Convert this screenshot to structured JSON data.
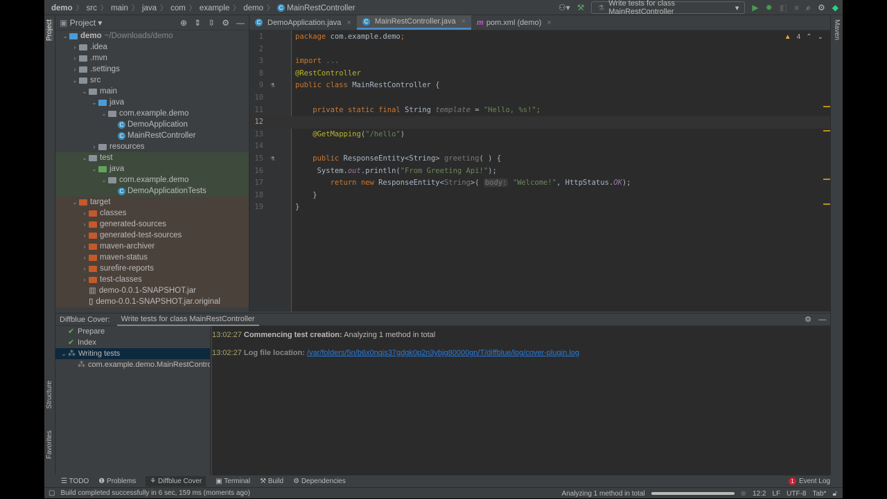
{
  "breadcrumb": [
    "demo",
    "src",
    "main",
    "java",
    "com",
    "example",
    "demo",
    "MainRestController"
  ],
  "toolbar": {
    "run_config": "Write tests for class MainRestController"
  },
  "project": {
    "title": "Project",
    "tree": [
      {
        "level": 0,
        "arrow": "v",
        "icon": "folder blue",
        "label": "demo",
        "extra": "~/Downloads/demo",
        "bold": true
      },
      {
        "level": 1,
        "arrow": ">",
        "icon": "folder",
        "label": ".idea"
      },
      {
        "level": 1,
        "arrow": ">",
        "icon": "folder",
        "label": ".mvn"
      },
      {
        "level": 1,
        "arrow": ">",
        "icon": "folder",
        "label": ".settings"
      },
      {
        "level": 1,
        "arrow": "v",
        "icon": "folder",
        "label": "src"
      },
      {
        "level": 2,
        "arrow": "v",
        "icon": "folder",
        "label": "main"
      },
      {
        "level": 3,
        "arrow": "v",
        "icon": "folder blue",
        "label": "java"
      },
      {
        "level": 4,
        "arrow": "v",
        "icon": "folder pkg",
        "label": "com.example.demo"
      },
      {
        "level": 5,
        "arrow": "",
        "icon": "class",
        "label": "DemoApplication"
      },
      {
        "level": 5,
        "arrow": "",
        "icon": "class",
        "label": "MainRestController"
      },
      {
        "level": 3,
        "arrow": ">",
        "icon": "folder",
        "label": "resources"
      },
      {
        "level": 2,
        "arrow": "v",
        "icon": "folder",
        "label": "test",
        "bg": "test"
      },
      {
        "level": 3,
        "arrow": "v",
        "icon": "folder green",
        "label": "java",
        "bg": "test"
      },
      {
        "level": 4,
        "arrow": "v",
        "icon": "folder pkg",
        "label": "com.example.demo",
        "bg": "test"
      },
      {
        "level": 5,
        "arrow": "",
        "icon": "class",
        "label": "DemoApplicationTests",
        "bg": "test"
      },
      {
        "level": 1,
        "arrow": "v",
        "icon": "folder orange",
        "label": "target",
        "bg": "target"
      },
      {
        "level": 2,
        "arrow": ">",
        "icon": "folder orange",
        "label": "classes",
        "bg": "target"
      },
      {
        "level": 2,
        "arrow": ">",
        "icon": "folder orange",
        "label": "generated-sources",
        "bg": "target"
      },
      {
        "level": 2,
        "arrow": ">",
        "icon": "folder orange",
        "label": "generated-test-sources",
        "bg": "target"
      },
      {
        "level": 2,
        "arrow": ">",
        "icon": "folder orange",
        "label": "maven-archiver",
        "bg": "target"
      },
      {
        "level": 2,
        "arrow": ">",
        "icon": "folder orange",
        "label": "maven-status",
        "bg": "target"
      },
      {
        "level": 2,
        "arrow": ">",
        "icon": "folder orange",
        "label": "surefire-reports",
        "bg": "target"
      },
      {
        "level": 2,
        "arrow": ">",
        "icon": "folder orange",
        "label": "test-classes",
        "bg": "target"
      },
      {
        "level": 2,
        "arrow": "",
        "icon": "jar",
        "label": "demo-0.0.1-SNAPSHOT.jar",
        "bg": "target"
      },
      {
        "level": 2,
        "arrow": "",
        "icon": "file",
        "label": "demo-0.0.1-SNAPSHOT.jar.original",
        "bg": "target"
      }
    ]
  },
  "tabs": [
    {
      "label": "DemoApplication.java",
      "active": false
    },
    {
      "label": "MainRestController.java",
      "active": true
    },
    {
      "label": "pom.xml (demo)",
      "active": false
    }
  ],
  "editor": {
    "warnings": "4",
    "lines": [
      {
        "n": "1",
        "t": [
          [
            "package ",
            "kw"
          ],
          [
            "com.example.demo",
            ""
          ],
          [
            ";",
            "kw"
          ]
        ]
      },
      {
        "n": "2",
        "t": []
      },
      {
        "n": "3",
        "t": [
          [
            "import ",
            "kw"
          ],
          [
            "...",
            "dim"
          ]
        ]
      },
      {
        "n": "8",
        "t": [
          [
            "@RestController",
            "ann"
          ]
        ]
      },
      {
        "n": "9",
        "t": [
          [
            "public class ",
            "kw"
          ],
          [
            "MainRestController {",
            ""
          ]
        ]
      },
      {
        "n": "10",
        "t": []
      },
      {
        "n": "11",
        "t": [
          [
            "    private static final ",
            "kw"
          ],
          [
            "String ",
            ""
          ],
          [
            "template",
            "gr"
          ],
          [
            " = ",
            ""
          ],
          [
            "\"Hello, %s!\"",
            "str"
          ],
          [
            ";",
            "kw"
          ]
        ]
      },
      {
        "n": "12",
        "t": [],
        "cur": true
      },
      {
        "n": "13",
        "t": [
          [
            "    @GetMapping",
            "ann"
          ],
          [
            "(",
            ""
          ],
          [
            "\"/hello\"",
            "str"
          ],
          [
            ")",
            ""
          ]
        ]
      },
      {
        "n": "14",
        "t": []
      },
      {
        "n": "15",
        "t": [
          [
            "    public ",
            "kw"
          ],
          [
            "ResponseEntity<String> ",
            ""
          ],
          [
            "greeting",
            "dim"
          ],
          [
            "( ) {",
            ""
          ]
        ]
      },
      {
        "n": "16",
        "t": [
          [
            "     System.",
            ""
          ],
          [
            "out",
            "it"
          ],
          [
            ".println(",
            ""
          ],
          [
            "\"From Greeting Api!\"",
            "str"
          ],
          [
            ");",
            ""
          ]
        ]
      },
      {
        "n": "17",
        "t": [
          [
            "        return new ",
            "kw"
          ],
          [
            "ResponseEntity<",
            ""
          ],
          [
            "String",
            "dim"
          ],
          [
            ">( ",
            ""
          ],
          [
            "body:",
            "hint"
          ],
          [
            " ",
            ""
          ],
          [
            "\"Welcome!\"",
            "str"
          ],
          [
            ", HttpStatus.",
            ""
          ],
          [
            "OK",
            "it"
          ],
          [
            ");",
            ""
          ]
        ]
      },
      {
        "n": "18",
        "t": [
          [
            "    }",
            ""
          ]
        ]
      },
      {
        "n": "19",
        "t": [
          [
            "}",
            ""
          ]
        ]
      }
    ]
  },
  "bottom": {
    "prefix": "Diffblue Cover:",
    "tab": "Write tests for class MainRestController",
    "steps": [
      {
        "label": "Prepare",
        "state": "done"
      },
      {
        "label": "Index",
        "state": "done"
      },
      {
        "label": "Writing tests",
        "state": "running"
      },
      {
        "label": "com.example.demo.MainRestController",
        "state": "running-child"
      }
    ],
    "log": [
      {
        "time": "13:02:27",
        "label": "Commencing test creation:",
        "text": " Analyzing 1 method in total"
      },
      {
        "time": "13:02:27",
        "label": "Log file location:",
        "link": "/var/folders/5n/b6x0nqjs37gdgk0p2n3ybjg80000gn/T/diffblue/log/cover-plugin.log"
      }
    ]
  },
  "toolwindows": [
    "TODO",
    "Problems",
    "Diffblue Cover",
    "Terminal",
    "Build",
    "Dependencies"
  ],
  "event_log": "Event Log",
  "event_count": "1",
  "status": {
    "message": "Build completed successfully in 6 sec, 159 ms (moments ago)",
    "progress_text": "Analyzing 1 method in total",
    "position": "12:2",
    "line_sep": "LF",
    "encoding": "UTF-8",
    "indent": "Tab*"
  },
  "side": {
    "project": "Project",
    "structure": "Structure",
    "favorites": "Favorites",
    "maven": "Maven"
  }
}
